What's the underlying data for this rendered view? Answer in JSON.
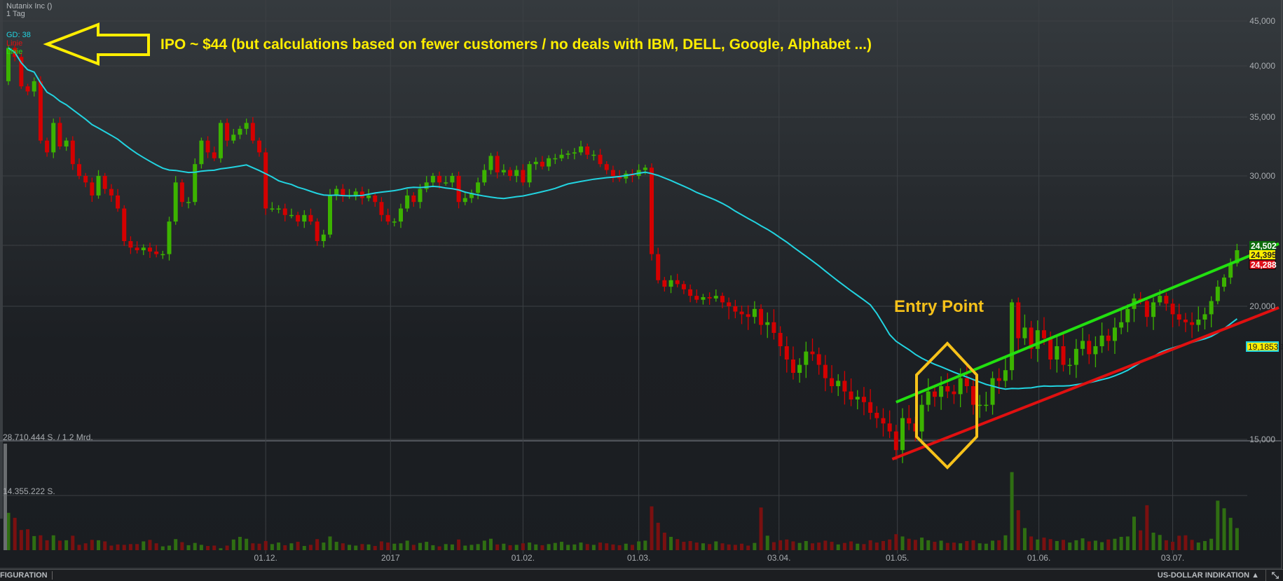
{
  "header": {
    "instrument": "Nutanix Inc ()",
    "interval": "1 Tag",
    "legend": [
      {
        "label": "GD: 38",
        "color": "#22d3e0"
      },
      {
        "label": "Linie",
        "color": "#e01010"
      },
      {
        "label": "Linie",
        "color": "#22e010"
      }
    ]
  },
  "annotations": {
    "ipo_note": "IPO ~ $44  (but calculations based on fewer customers / no deals with IBM, DELL, Google, Alphabet ...)",
    "ipo_arrow_icon": "left-arrow-outline",
    "entry_label": "Entry Point",
    "entry_shape": "hexagon",
    "arrow_color": "#ffee00",
    "entry_color": "#f7c21a"
  },
  "price_tags": [
    {
      "label": "24,502",
      "bg": "#0b6b0b",
      "fg": "#ffffff"
    },
    {
      "label": "24,395",
      "bg": "#ffee00",
      "fg": "#222222"
    },
    {
      "label": "24,288",
      "bg": "#e0101a",
      "fg": "#ffffff"
    },
    {
      "label": "19,18539",
      "bg": "#ffee00",
      "fg": "#222222",
      "border": "#22d3e0"
    }
  ],
  "volume_axis": {
    "top_label": "28.710.444 S. / 1.2 Mrd.",
    "mid_label": "14.355.222 S.",
    "max": 28.710444
  },
  "footer": {
    "left": "FIGURATION",
    "right": "US-DOLLAR INDIKATION ▲",
    "resize_icon": "expand-diagonal-icon"
  },
  "chart_data": {
    "type": "candlestick",
    "title": "Nutanix Inc ()",
    "ylabel": "",
    "xlabel": "",
    "ylim": [
      14,
      46
    ],
    "grid": true,
    "y_ticks": [
      {
        "value": 45,
        "label": "45,000"
      },
      {
        "value": 40,
        "label": "40,000"
      },
      {
        "value": 35,
        "label": "35,000"
      },
      {
        "value": 30,
        "label": "30,000"
      },
      {
        "value": 20,
        "label": "20,000"
      },
      {
        "value": 15,
        "label": "15,000"
      }
    ],
    "x_ticks": [
      {
        "label": "01.12.",
        "index": 40
      },
      {
        "label": "2017",
        "index": 59.4
      },
      {
        "label": "01.02.",
        "index": 80
      },
      {
        "label": "01.03.",
        "index": 98
      },
      {
        "label": "03.04.",
        "index": 119.8
      },
      {
        "label": "01.05.",
        "index": 138.2
      },
      {
        "label": "01.06.",
        "index": 160.2
      },
      {
        "label": "03.07.",
        "index": 181
      }
    ],
    "moving_average_period": 38,
    "first_open": 38.5,
    "close": [
      42,
      41,
      38,
      37.5,
      38.5,
      33,
      32,
      34.5,
      32.5,
      33,
      31,
      30,
      29.5,
      28.5,
      30,
      29,
      28.5,
      27.5,
      25,
      24.5,
      24.3,
      24.5,
      24.2,
      24,
      24,
      26.5,
      29.5,
      28,
      28,
      31,
      33,
      32,
      31.5,
      34.5,
      33,
      33.5,
      34,
      34.5,
      33,
      32,
      27.5,
      27.5,
      27.5,
      27,
      27,
      26.5,
      27,
      26.5,
      25,
      25.5,
      28.5,
      29,
      28.5,
      28.5,
      28.8,
      28.3,
      28.5,
      28,
      27,
      26.5,
      26.5,
      27.5,
      28.5,
      28,
      29,
      29.5,
      30,
      29.5,
      29.5,
      30,
      28,
      28.3,
      28.7,
      29.5,
      30.5,
      31.7,
      30.3,
      30.5,
      30,
      30.5,
      29.5,
      31,
      31.2,
      30.8,
      31.5,
      31.5,
      31.8,
      31.9,
      32,
      32.5,
      31.8,
      31.8,
      31,
      30.5,
      30,
      29.8,
      30.2,
      30,
      30.5,
      30.7,
      24,
      22,
      21.5,
      22,
      21.7,
      21.3,
      20.8,
      20.5,
      20.7,
      20.6,
      20.8,
      20.3,
      20,
      19.8,
      19.7,
      19.6,
      19.9,
      19.3,
      19.4,
      19,
      18.5,
      18,
      17.5,
      17.8,
      18.3,
      18.2,
      17.8,
      17.3,
      17,
      17.2,
      16.8,
      16.5,
      16.6,
      16.4,
      16,
      15.8,
      15.6,
      15.3,
      14.6,
      15.8,
      15.6,
      15.3,
      16.3,
      16.8,
      16.6,
      17,
      16.8,
      16.7,
      17.3,
      17,
      16.3,
      16.3,
      16.3,
      17.3,
      17.2,
      17.6,
      20.3,
      18.8,
      19.2,
      18.4,
      19.1,
      18.8,
      18,
      18.5,
      17.8,
      17.8,
      18.4,
      18.7,
      18.2,
      18.5,
      18.9,
      18.7,
      19.2,
      19.4,
      19.9,
      20.6,
      20.4,
      19.6,
      20.3,
      20.8,
      20.2,
      19.7,
      19.5,
      19.4,
      19.3,
      19.5,
      19.7,
      20.4,
      21.5,
      22.2,
      23.3,
      24.3
    ],
    "volume_millions": [
      9.8,
      8.5,
      5.3,
      5.5,
      3.7,
      3.9,
      2.6,
      3.9,
      2.5,
      2.6,
      3.8,
      1.4,
      1.8,
      2.7,
      2.6,
      2.3,
      1.2,
      1.5,
      1.4,
      1.6,
      1.6,
      2.3,
      2.7,
      1.8,
      1.0,
      1.2,
      2.9,
      2.1,
      1.3,
      1.9,
      1.4,
      1.1,
      1.2,
      0.5,
      1.2,
      2.8,
      3.5,
      3.0,
      1.8,
      1.7,
      2.4,
      1.6,
      2.0,
      1.3,
      1.8,
      2.2,
      1.1,
      1.4,
      2.9,
      2.0,
      3.6,
      2.2,
      1.8,
      1.4,
      1.2,
      1.6,
      1.5,
      1.1,
      2.3,
      2.0,
      1.7,
      1.8,
      2.5,
      1.4,
      1.9,
      2.2,
      1.3,
      1.0,
      1.6,
      1.5,
      2.8,
      1.2,
      1.4,
      1.6,
      2.5,
      3.0,
      1.5,
      1.7,
      1.3,
      1.4,
      1.8,
      2.0,
      1.5,
      1.3,
      1.6,
      1.9,
      2.2,
      1.4,
      1.5,
      2.0,
      1.6,
      1.4,
      2.0,
      1.8,
      1.5,
      1.3,
      1.7,
      1.4,
      2.3,
      2.5,
      11.5,
      7.2,
      4.6,
      3.5,
      2.9,
      2.2,
      2.4,
      2.0,
      1.8,
      1.6,
      2.3,
      1.8,
      1.5,
      1.4,
      1.7,
      1.2,
      1.9,
      11.2,
      3.8,
      2.1,
      2.6,
      2.8,
      2.3,
      1.9,
      2.4,
      1.8,
      2.0,
      2.5,
      2.2,
      1.5,
      1.9,
      2.3,
      1.7,
      1.6,
      2.6,
      2.0,
      2.4,
      2.8,
      4.2,
      3.6,
      3.0,
      2.7,
      3.3,
      2.6,
      2.2,
      2.5,
      1.9,
      2.0,
      1.8,
      2.4,
      2.6,
      1.8,
      1.7,
      2.5,
      2.6,
      3.9,
      20.5,
      10.5,
      5.8,
      3.6,
      2.8,
      3.3,
      2.9,
      2.4,
      2.7,
      2.0,
      2.6,
      3.1,
      2.3,
      2.5,
      2.1,
      2.8,
      3.0,
      3.5,
      3.6,
      8.8,
      5.2,
      11.8,
      4.6,
      4.0,
      2.6,
      2.2,
      3.8,
      3.9,
      2.7,
      2.0,
      2.4,
      3.0,
      13.0,
      11.0,
      8.5,
      5.8
    ],
    "trend_lines": [
      {
        "color": "#22e010",
        "from": [
          138,
          16.4
        ],
        "to": [
          197.5,
          24.8
        ]
      },
      {
        "color": "#e01010",
        "from": [
          137.4,
          14.26
        ],
        "to": [
          197.5,
          19.95
        ]
      }
    ],
    "colors": {
      "up": "#3cb300",
      "down": "#d40000",
      "ma": "#22d3e0",
      "vol_up": "#2f6e12",
      "vol_down": "#7a1010"
    }
  }
}
